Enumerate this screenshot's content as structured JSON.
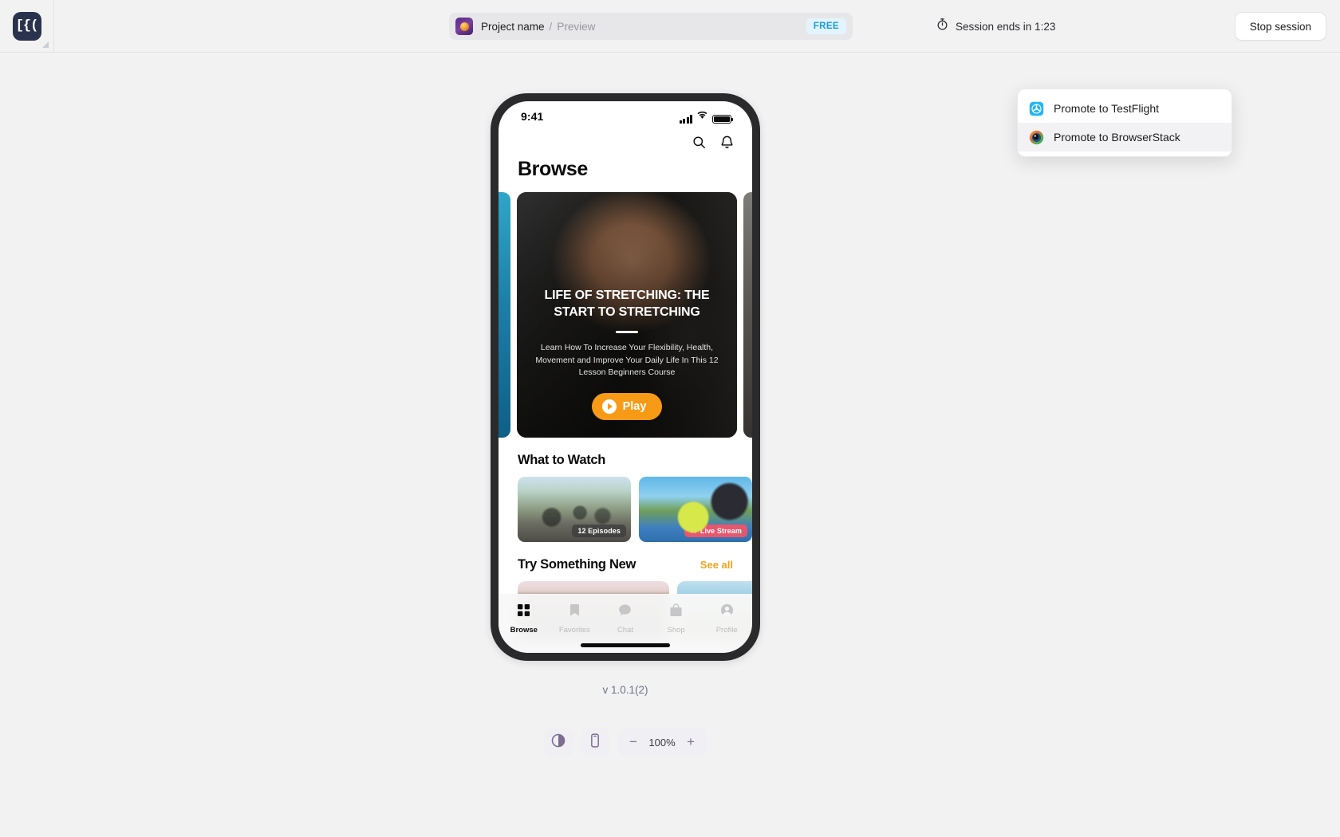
{
  "topbar": {
    "logo_glyph": "[{(",
    "logo_icon_name": "app-logo-icon",
    "project_name": "Project name",
    "separator": "/",
    "preview_label": "Preview",
    "plan_badge": "FREE",
    "session_text": "Session ends in 1:23",
    "stop_session_label": "Stop session",
    "timer_icon": "stopwatch-icon"
  },
  "menu": {
    "items": [
      {
        "label": "Promote to TestFlight",
        "icon": "testflight-icon",
        "hovered": false
      },
      {
        "label": "Promote to BrowserStack",
        "icon": "browserstack-icon",
        "hovered": true
      }
    ]
  },
  "phone": {
    "statusbar": {
      "time": "9:41",
      "signal_icon": "cellular-bars-icon",
      "wifi_icon": "wifi-icon",
      "battery_icon": "battery-full-icon"
    },
    "nav": {
      "search_icon": "search-icon",
      "bell_icon": "notification-bell-icon"
    },
    "page_title": "Browse",
    "hero": {
      "title": "LIFE OF STRETCHING: THE START TO STRETCHING",
      "subtitle": "Learn How To Increase Your Flexibility, Health, Movement and Improve Your Daily Life In This 12 Lesson Beginners Course",
      "play_label": "Play",
      "play_icon": "play-circle-icon"
    },
    "sections": [
      {
        "title": "What to Watch",
        "see_all": "",
        "cards": [
          {
            "badge": "12 Episodes",
            "badge_type": "count"
          },
          {
            "badge": "Live Stream",
            "badge_type": "live",
            "badge_icon": "live-broadcast-icon"
          },
          {
            "badge": "",
            "badge_type": "none"
          }
        ]
      },
      {
        "title": "Try Something New",
        "see_all": "See all",
        "cards": [
          {
            "badge": ""
          },
          {
            "badge": ""
          }
        ]
      }
    ],
    "tabs": [
      {
        "label": "Browse",
        "icon": "grid-icon",
        "active": true
      },
      {
        "label": "Favorites",
        "icon": "bookmark-icon",
        "active": false
      },
      {
        "label": "Chat",
        "icon": "chat-bubble-icon",
        "active": false
      },
      {
        "label": "Shop",
        "icon": "shopping-bag-icon",
        "active": false
      },
      {
        "label": "Profile",
        "icon": "person-circle-icon",
        "active": false
      }
    ]
  },
  "version_label": "v 1.0.1(2)",
  "bottombar": {
    "appearance_icon": "contrast-toggle-icon",
    "device_icon": "device-phone-icon",
    "zoom_out_label": "−",
    "zoom_value": "100%",
    "zoom_in_label": "+"
  },
  "colors": {
    "accent_orange": "#f79b16",
    "see_all": "#f0a31e",
    "plan_badge_bg": "#e4f4fe",
    "plan_badge_fg": "#1b9ae0",
    "live_badge": "#e8566d",
    "logo_bg": "#29334d",
    "toolbar_purple": "#7c6d91"
  }
}
